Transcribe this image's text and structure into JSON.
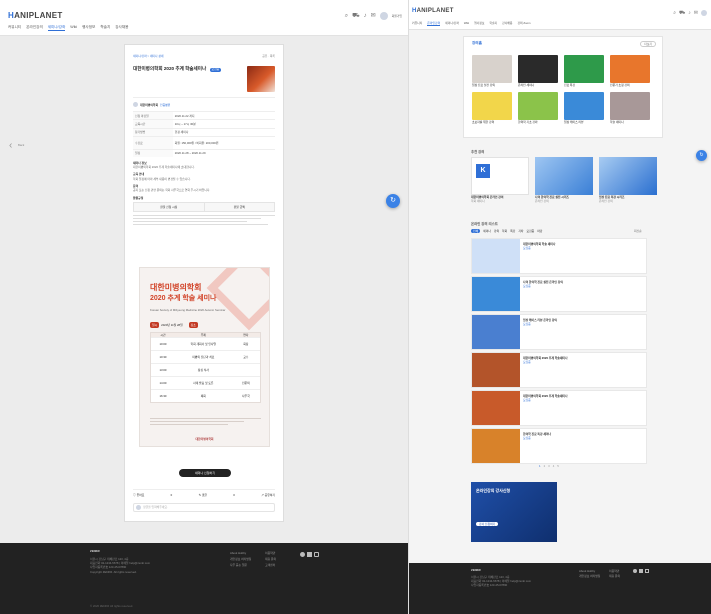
{
  "app": {
    "logo_prefix": "H",
    "logo_rest": "ANIPLANET",
    "user_badge": "회원가입"
  },
  "nav": [
    "커뮤니티",
    "온라인강의",
    "세미나/강좌",
    "Wiki",
    "행사정보",
    "학술지",
    "강사채용",
    "강의 Zoom",
    "일정관리"
  ],
  "left": {
    "prev_label": "Back",
    "breadcrumb": [
      "세미나/강좌",
      "세미나 상세"
    ],
    "share_label": "공유",
    "list_label": "목록",
    "title": "대한미병의학회 2020 추계 학술세미나",
    "badge": "모집중",
    "host_name": "대한미병의학회",
    "host_verified": "인증병원",
    "info_rows": [
      [
        "신청 마감일",
        "2020.11.22 까지"
      ],
      [
        "교육시간",
        "10시 ~ 17시 30분"
      ],
      [
        "참가방법",
        "현장 세미나"
      ],
      [
        "수강료",
        "회원: 150,000원 / 비회원: 200,000원"
      ],
      [
        "일정",
        "2020.11.28 ~ 2020.11.29"
      ]
    ],
    "section_titles": [
      "세미나 정보",
      "교육 안내",
      "문의"
    ],
    "section_texts": [
      "대한미병의학회 2020 추계 학술세미나에 초대합니다.",
      "학회 일정에 따라 세부 내용이 변경될 수 있습니다.",
      "공지 또는 신청 관련 문의는 학회 사무국으로 연락 주시기 바랍니다."
    ],
    "refund_title": "환불규정",
    "refund_col": [
      "환불 신청 시점",
      "환불 금액"
    ],
    "poster": {
      "title_line1": "대한미병의학회",
      "title_line2": "2020 추계 학술 세미나",
      "subtitle": "Korean Society of Mibyeong Medicine 2020 Autumn Seminar",
      "date_tag": "일시",
      "date_val": "2020년 11월 28일",
      "place_tag": "장소",
      "rows": [
        [
          "10:00",
          "학회 개회사 및 인사말",
          "회장"
        ],
        [
          "10:30",
          "미병의 진단과 치료",
          "교수"
        ],
        [
          "13:00",
          "점심 식사",
          ""
        ],
        [
          "14:00",
          "사례 발표 및 토론",
          "전문의"
        ],
        [
          "16:30",
          "폐회",
          "사무국"
        ]
      ],
      "cols": [
        "시간",
        "주제",
        "연자"
      ],
      "footer_org": "대한미병의학회"
    },
    "apply_button": "세미나 신청하기",
    "actions": [
      "좋아요",
      "0",
      "댓글",
      "0",
      "공유하기"
    ],
    "comment_placeholder": "댓글을 입력해주세요."
  },
  "right": {
    "section1": {
      "title": "강의홈",
      "more": "더보기"
    },
    "lecture_cards": [
      {
        "title": "임상 진료 실전 강의",
        "color": "#d8d2cc"
      },
      {
        "title": "온라인 세미나",
        "color": "#2a2a2a"
      },
      {
        "title": "진료 특강",
        "color": "#2e9a4a"
      },
      {
        "title": "전문가 초청 강의",
        "color": "#e8762c"
      },
      {
        "title": "초보자를 위한 강의",
        "color": "#f2d64a"
      },
      {
        "title": "한의학 기초 강좌",
        "color": "#8bc34a"
      },
      {
        "title": "임상 케이스 리뷰",
        "color": "#3a8ad8"
      },
      {
        "title": "학술 세미나",
        "color": "#a89898"
      }
    ],
    "section2": {
      "title": "추천 강의"
    },
    "rec_cards": [
      {
        "title": "대한미병의학회 온라인 강의",
        "sub": "학회 세미나"
      },
      {
        "title": "나의 한의학 진료 실전 시리즈",
        "sub": "온라인 강의"
      },
      {
        "title": "임상 진료 특강 시리즈",
        "sub": "온라인 강의"
      }
    ],
    "section3": {
      "title": "온라인 강의 리스트",
      "filter": "최신순"
    },
    "filters": [
      "전체",
      "세미나",
      "강의",
      "학회",
      "특강",
      "기타",
      "모집중",
      "마감"
    ],
    "list_items": [
      {
        "title": "대한미병의학회 학술 세미나",
        "tag": "모집중",
        "color": "#cfe0f7"
      },
      {
        "title": "나의 한의학 진료 실전 온라인 강의",
        "tag": "모집중",
        "color": "#3a8ad8"
      },
      {
        "title": "임상 케이스 리뷰 온라인 강의",
        "tag": "모집중",
        "color": "#4a7fd0"
      },
      {
        "title": "대한미병의학회 2020 추계 학술세미나",
        "tag": "모집중",
        "color": "#b3542a"
      },
      {
        "title": "대한미병의학회 2020 추계 학술세미나",
        "tag": "모집중",
        "color": "#c85a2a"
      },
      {
        "title": "한의학 진료 특강 세미나",
        "tag": "모집중",
        "color": "#d8822a"
      }
    ],
    "pagination": [
      "1",
      "2",
      "3",
      "4",
      "5"
    ],
    "banner": {
      "title": "온라인강의 강사신청",
      "button": "강사 신청하기"
    }
  },
  "footer": {
    "brand": "ZENKR",
    "lines": [
      "서울시 강남구 테헤란로 123, 4층",
      "대표전화 02-1234-5678 | 이메일 help@zenkr.com",
      "사업자등록번호 123-45-67890",
      "Copyright ZENKR. All rights reserved."
    ],
    "links": [
      "About Hubby",
      "이용약관",
      "개인정보 처리방침",
      "제휴 문의",
      "자주 묻는 질문",
      "고객센터"
    ],
    "copyright": "© 2020 ZENKR All rights reserved."
  },
  "colors": {
    "accent": "#2f6fd6",
    "footer_bg": "#222222"
  }
}
